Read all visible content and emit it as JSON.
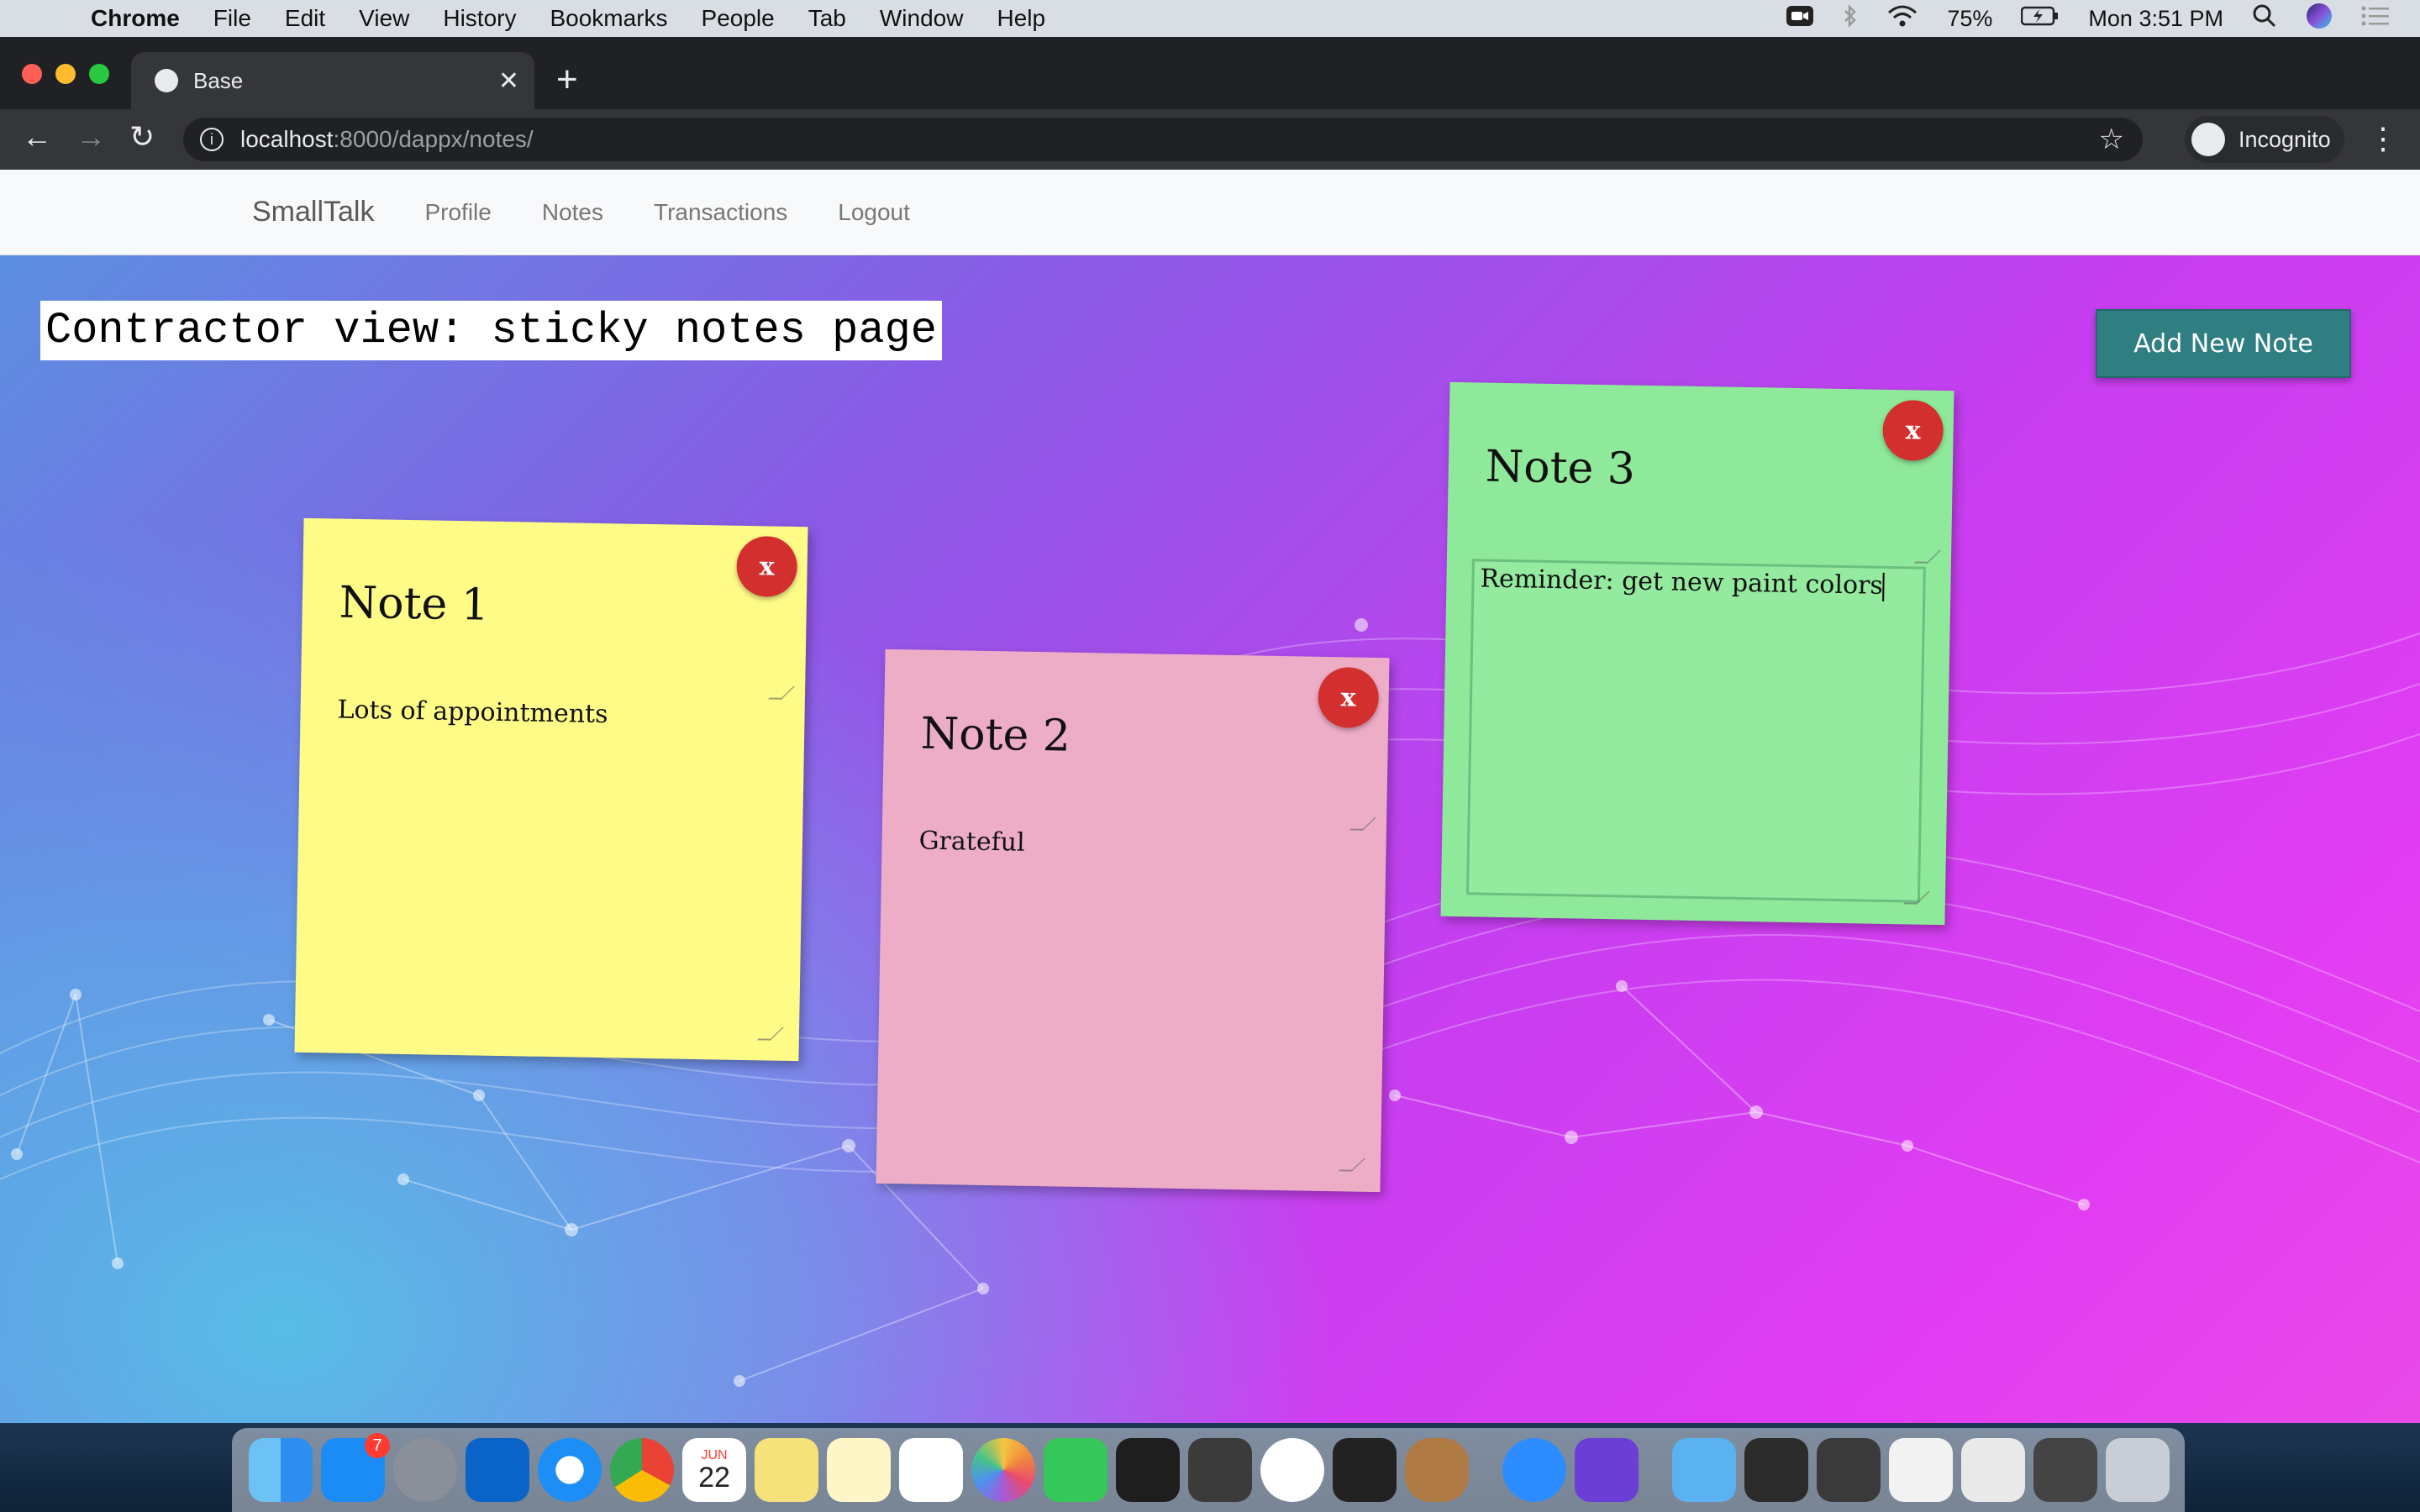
{
  "menubar": {
    "app_name": "Chrome",
    "items": [
      "File",
      "Edit",
      "View",
      "History",
      "Bookmarks",
      "People",
      "Tab",
      "Window",
      "Help"
    ],
    "battery": "75%",
    "clock": "Mon 3:51 PM"
  },
  "browser": {
    "tab_title": "Base",
    "url_host": "localhost",
    "url_path": ":8000/dappx/notes/",
    "incognito_label": "Incognito"
  },
  "site": {
    "brand": "SmallTalk",
    "nav": [
      "Profile",
      "Notes",
      "Transactions",
      "Logout"
    ]
  },
  "page": {
    "title": "Contractor view: sticky notes page",
    "add_button": "Add New Note"
  },
  "notes": [
    {
      "title": "Note 1",
      "body": "Lots of appointments",
      "color": "#fefb87"
    },
    {
      "title": "Note 2",
      "body": "Grateful",
      "color": "#eeadc7"
    },
    {
      "title": "Note 3",
      "body": "Reminder: get new paint colors",
      "color": "#8fe99a"
    }
  ],
  "delete_label": "x",
  "dock": {
    "app_store_badge": "7",
    "calendar_month": "JUN",
    "calendar_day": "22"
  }
}
